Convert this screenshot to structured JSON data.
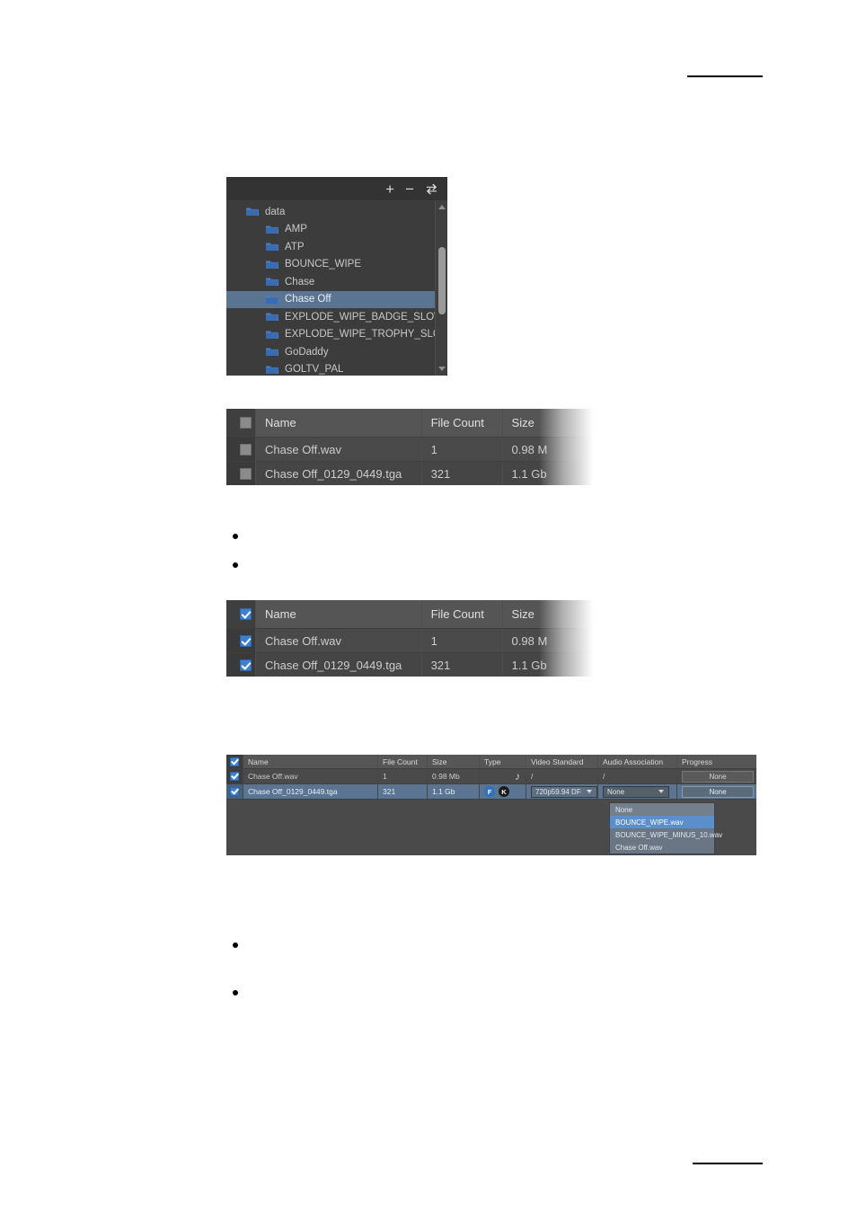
{
  "page": {
    "background": "#ffffff",
    "redaction_lines": [
      {
        "name": "top-rule"
      },
      {
        "name": "bottom-rule"
      }
    ],
    "bullets": [
      "",
      "",
      "",
      ""
    ]
  },
  "tree_panel": {
    "toolbar": {
      "add_label": "+",
      "remove_label": "−",
      "refresh_icon": "refresh-icon"
    },
    "selected_colour": "#5a7491",
    "items": [
      {
        "label": "data",
        "depth": 0,
        "selected": false,
        "expander": true
      },
      {
        "label": "AMP",
        "depth": 1,
        "selected": false,
        "expander": false
      },
      {
        "label": "ATP",
        "depth": 1,
        "selected": false,
        "expander": false
      },
      {
        "label": "BOUNCE_WIPE",
        "depth": 1,
        "selected": false,
        "expander": false
      },
      {
        "label": "Chase",
        "depth": 1,
        "selected": false,
        "expander": false
      },
      {
        "label": "Chase Off",
        "depth": 1,
        "selected": true,
        "expander": false
      },
      {
        "label": "EXPLODE_WIPE_BADGE_SLOW",
        "depth": 1,
        "selected": false,
        "expander": false
      },
      {
        "label": "EXPLODE_WIPE_TROPHY_SLOW",
        "depth": 1,
        "selected": false,
        "expander": false
      },
      {
        "label": "GoDaddy",
        "depth": 1,
        "selected": false,
        "expander": false
      },
      {
        "label": "GOLTV_PAL",
        "depth": 1,
        "selected": false,
        "expander": false
      }
    ]
  },
  "table_one": {
    "headers": {
      "check": "",
      "name": "Name",
      "count": "File Count",
      "size": "Size"
    },
    "header_checked": false,
    "rows": [
      {
        "checked": false,
        "name": "Chase Off.wav",
        "count": "1",
        "size": "0.98 M"
      },
      {
        "checked": false,
        "name": "Chase Off_0129_0449.tga",
        "count": "321",
        "size": "1.1 Gb"
      }
    ]
  },
  "table_two": {
    "headers": {
      "check": "",
      "name": "Name",
      "count": "File Count",
      "size": "Size"
    },
    "header_checked": true,
    "rows": [
      {
        "checked": true,
        "name": "Chase Off.wav",
        "count": "1",
        "size": "0.98 M"
      },
      {
        "checked": true,
        "name": "Chase Off_0129_0449.tga",
        "count": "321",
        "size": "1.1 Gb"
      }
    ]
  },
  "table_three": {
    "headers": {
      "check": "",
      "name": "Name",
      "count": "File Count",
      "size": "Size",
      "type": "Type",
      "video_standard": "Video Standard",
      "audio_association": "Audio Association",
      "progress": "Progress"
    },
    "header_checked": true,
    "rows": [
      {
        "checked": true,
        "name": "Chase Off.wav",
        "count": "1",
        "size": "0.98 Mb",
        "type_icon": "music-note-icon",
        "type_badges": [],
        "video_standard": "/",
        "audio_association": "/",
        "progress": "None",
        "selected": false
      },
      {
        "checked": true,
        "name": "Chase Off_0129_0449.tga",
        "count": "321",
        "size": "1.1 Gb",
        "type_icon": "",
        "type_badges": [
          "F",
          "K"
        ],
        "video_standard": "720p59.94 DF",
        "audio_association": "None",
        "progress": "None",
        "selected": true
      }
    ],
    "audio_dropdown": {
      "open": true,
      "options": [
        {
          "label": "None",
          "state": "current"
        },
        {
          "label": "BOUNCE_WIPE.wav",
          "state": "highlight"
        },
        {
          "label": "BOUNCE_WIPE_MINUS_10.wav",
          "state": "normal"
        },
        {
          "label": "Chase Off.wav",
          "state": "normal"
        }
      ]
    }
  }
}
